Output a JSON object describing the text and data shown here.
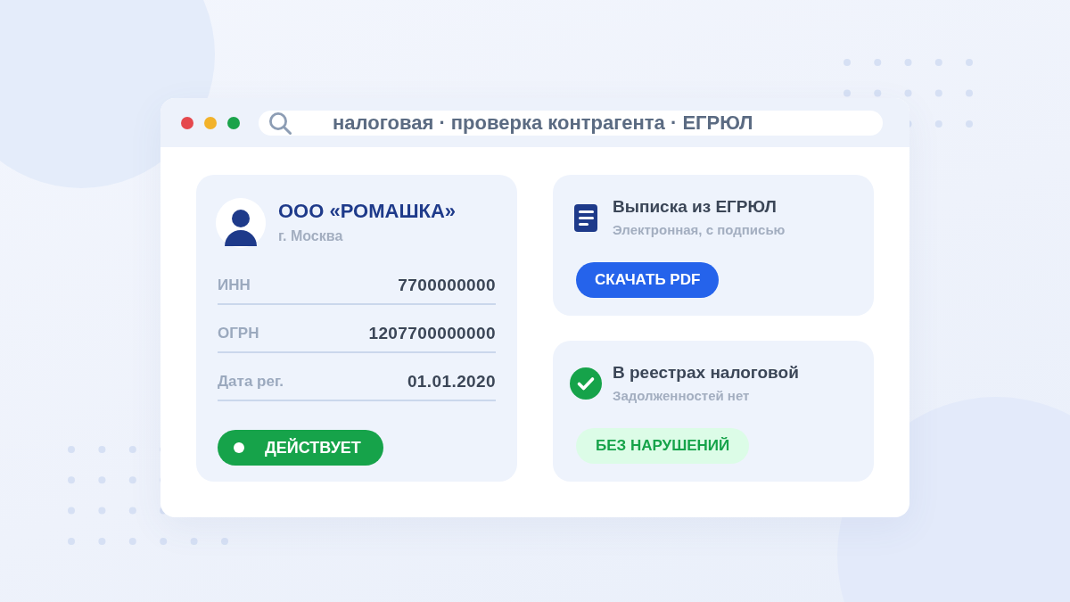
{
  "window": {
    "controls": [
      {
        "color": "#e5484d"
      },
      {
        "color": "#f2b22a"
      },
      {
        "color": "#1aa34a"
      }
    ]
  },
  "address_bar": {
    "text": "налоговая · проверка контрагента · ЕГРЮЛ"
  },
  "company_card": {
    "name": "ООО «РОМАШКА»",
    "city": "г. Москва",
    "fields": [
      {
        "label": "ИНН",
        "value": "7700000000"
      },
      {
        "label": "ОГРН",
        "value": "1207700000000"
      },
      {
        "label": "Дата рег.",
        "value": "01.01.2020"
      }
    ],
    "status": "ДЕЙСТВУЕТ"
  },
  "cards": [
    {
      "kind": "download",
      "title": "Выписка из ЕГРЮЛ",
      "subtitle": "Электронная, с подписью",
      "button": "СКАЧАТЬ PDF"
    },
    {
      "kind": "check",
      "title": "В реестрах налоговой",
      "subtitle": "Задолженностей нет",
      "badge": "БЕЗ НАРУШЕНИЙ"
    }
  ]
}
